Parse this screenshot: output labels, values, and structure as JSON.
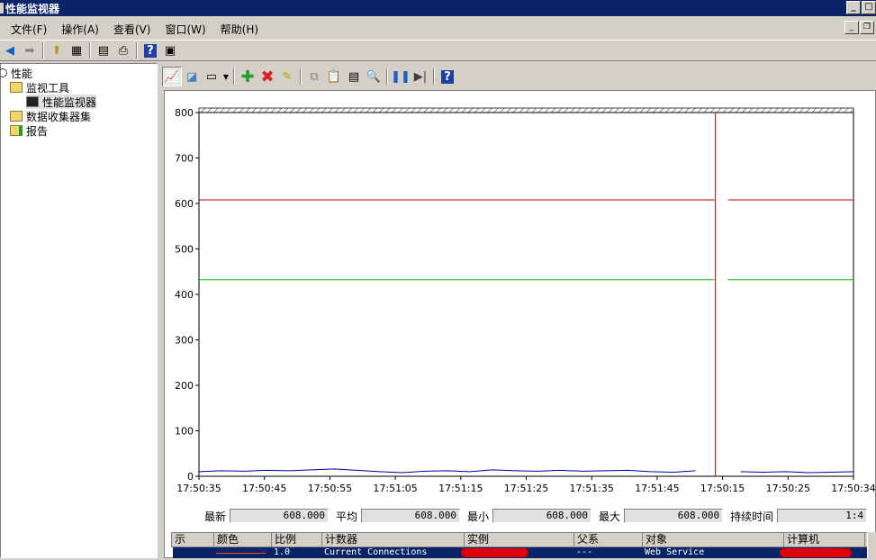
{
  "window": {
    "title": "性能监视器"
  },
  "menu": [
    "文件(F)",
    "操作(A)",
    "查看(V)",
    "窗口(W)",
    "帮助(H)"
  ],
  "tree": {
    "root": "性能",
    "monitor_tools": "监视工具",
    "perf_monitor": "性能监视器",
    "data_collector": "数据收集器集",
    "reports": "报告"
  },
  "stats": {
    "latest_label": "最新",
    "latest": "608.000",
    "average_label": "平均",
    "average": "608.000",
    "min_label": "最小",
    "min": "608.000",
    "max_label": "最大",
    "max": "608.000",
    "duration_label": "持续时间",
    "duration": "1:4"
  },
  "legend": {
    "headers": [
      "示",
      "颜色",
      "比例",
      "计数器",
      "实例",
      "父系",
      "对象",
      "计算机"
    ],
    "row": {
      "scale": "1.0",
      "counter": "Current Connections",
      "parent": "---",
      "object": "Web Service"
    }
  },
  "colors": {
    "series_red": "#c00000",
    "series_green": "#00c000",
    "series_blue": "#0000a0",
    "time_bar": "#c00000"
  },
  "chart_data": {
    "type": "line",
    "ylim": [
      0,
      800
    ],
    "yticks": [
      "800",
      "700",
      "600",
      "500",
      "400",
      "300",
      "200",
      "100",
      "0"
    ],
    "xticks": [
      "17:50:35",
      "17:50:45",
      "17:50:55",
      "17:51:05",
      "17:51:15",
      "17:51:25",
      "17:51:35",
      "17:51:45",
      "17:50:15",
      "17:50:25",
      "17:50:34"
    ],
    "series": [
      {
        "color": "#c00000",
        "values": [
          608,
          608,
          608,
          608,
          608,
          608,
          608,
          608,
          608,
          608,
          608
        ]
      },
      {
        "color": "#00c000",
        "values": [
          432,
          432,
          432,
          432,
          432,
          432,
          432,
          432,
          432,
          432,
          432
        ]
      },
      {
        "color": "#0000a0",
        "values": [
          10,
          12,
          11,
          13,
          12,
          14,
          16,
          13,
          10,
          8,
          11,
          12,
          10,
          14,
          12,
          11,
          13,
          11,
          12,
          13,
          10,
          9,
          12,
          11,
          10,
          9,
          10,
          8,
          9,
          10
        ]
      }
    ]
  }
}
